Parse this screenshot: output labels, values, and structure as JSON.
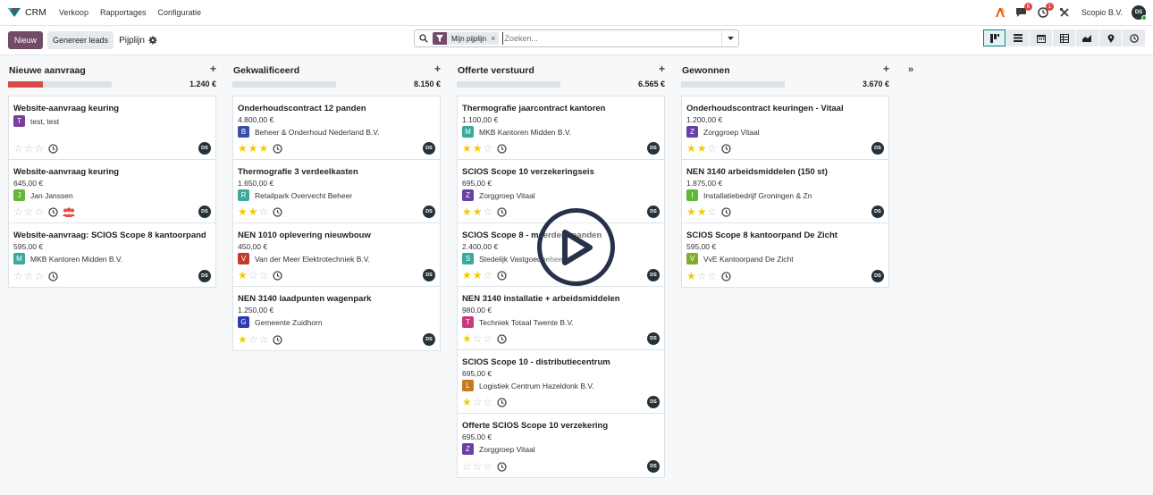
{
  "navbar": {
    "app_name": "CRM",
    "menu": [
      "Verkoop",
      "Rapportages",
      "Configuratie"
    ],
    "company": "Scopio B.V.",
    "user_initials": "DS",
    "messages_badge": "6",
    "activities_badge": "1"
  },
  "control": {
    "new_label": "Nieuw",
    "leads_label": "Genereer leads",
    "breadcrumb": "Pijplijn",
    "search": {
      "facet_label": "Mijn pijplijn",
      "facet_remove": "×",
      "placeholder": "Zoeken..."
    },
    "views": [
      "kanban",
      "list",
      "calendar",
      "pivot",
      "graph",
      "map",
      "activity"
    ],
    "active_view": "kanban"
  },
  "colors": {
    "primary": "#714b67",
    "accent": "#017e84",
    "star": "#f3cc00",
    "progress_red": "#d94b4b"
  },
  "columns": [
    {
      "title": "Nieuwe aanvraag",
      "add": "+",
      "total": "1.240 €",
      "progress_red_fraction": 0.34,
      "cards": [
        {
          "title": "Website-aanvraag keuring",
          "amount": "",
          "partner": "test, test",
          "initial": "T",
          "color": "#7b3f99",
          "stars": 0,
          "people_icon": false,
          "user": "DS"
        },
        {
          "title": "Website-aanvraag keuring",
          "amount": "645,00 €",
          "partner": "Jan Janssen",
          "initial": "J",
          "color": "#5fb932",
          "stars": 0,
          "people_icon": true,
          "user": "DS"
        },
        {
          "title": "Website-aanvraag: SCIOS Scope 8 kantoorpand",
          "amount": "595,00 €",
          "partner": "MKB Kantoren Midden B.V.",
          "initial": "M",
          "color": "#3aa9a0",
          "stars": 0,
          "people_icon": false,
          "user": "DS"
        }
      ]
    },
    {
      "title": "Gekwalificeerd",
      "add": "+",
      "total": "8.150 €",
      "progress_red_fraction": 0,
      "cards": [
        {
          "title": "Onderhoudscontract 12 panden",
          "amount": "4.800,00 €",
          "partner": "Beheer & Onderhoud Nederland B.V.",
          "initial": "B",
          "color": "#3c4fa8",
          "stars": 3,
          "user": "DS"
        },
        {
          "title": "Thermografie 3 verdeelkasten",
          "amount": "1.650,00 €",
          "partner": "Retailpark Overvecht Beheer",
          "initial": "R",
          "color": "#3aa9a0",
          "stars": 2,
          "user": "DS"
        },
        {
          "title": "NEN 1010 oplevering nieuwbouw",
          "amount": "450,00 €",
          "partner": "Van der Meer Elektrotechniek B.V.",
          "initial": "V",
          "color": "#c2392d",
          "stars": 1,
          "user": "DS"
        },
        {
          "title": "NEN 3140 laadpunten wagenpark",
          "amount": "1.250,00 €",
          "partner": "Gemeente Zuidhorn",
          "initial": "G",
          "color": "#2a3bb2",
          "stars": 1,
          "user": "DS"
        }
      ]
    },
    {
      "title": "Offerte verstuurd",
      "add": "+",
      "total": "6.565 €",
      "progress_red_fraction": 0,
      "cards": [
        {
          "title": "Thermografie jaarcontract kantoren",
          "amount": "1.100,00 €",
          "partner": "MKB Kantoren Midden B.V.",
          "initial": "M",
          "color": "#3aa9a0",
          "stars": 2,
          "user": "DS"
        },
        {
          "title": "SCIOS Scope 10 verzekeringseis",
          "amount": "695,00 €",
          "partner": "Zorggroep Vitaal",
          "initial": "Z",
          "color": "#6a3fa6",
          "stars": 2,
          "user": "DS"
        },
        {
          "title": "SCIOS Scope 8 - meerdere panden",
          "amount": "2.400,00 €",
          "partner": "Stedelijk Vastgoedbeheer",
          "initial": "S",
          "color": "#3aa9a0",
          "stars": 2,
          "user": "DS"
        },
        {
          "title": "NEN 3140 installatie + arbeidsmiddelen",
          "amount": "980,00 €",
          "partner": "Techniek Totaal Twente B.V.",
          "initial": "T",
          "color": "#c73b7d",
          "stars": 1,
          "user": "DS"
        },
        {
          "title": "SCIOS Scope 10 - distributiecentrum",
          "amount": "695,00 €",
          "partner": "Logistiek Centrum Hazeldonk B.V.",
          "initial": "L",
          "color": "#c17a20",
          "stars": 1,
          "user": "DS"
        },
        {
          "title": "Offerte SCIOS Scope 10 verzekering",
          "amount": "695,00 €",
          "partner": "Zorggroep Vitaal",
          "initial": "Z",
          "color": "#6a3fa6",
          "stars": 0,
          "user": "DS"
        }
      ]
    },
    {
      "title": "Gewonnen",
      "add": "+",
      "total": "3.670 €",
      "progress_red_fraction": 0,
      "cards": [
        {
          "title": "Onderhoudscontract keuringen - Vitaal",
          "amount": "1.200,00 €",
          "partner": "Zorggroep Vitaal",
          "initial": "Z",
          "color": "#6a3fa6",
          "stars": 2,
          "user": "DS"
        },
        {
          "title": "NEN 3140 arbeidsmiddelen (150 st)",
          "amount": "1.875,00 €",
          "partner": "Installatiebedrijf Groningen & Zn",
          "initial": "I",
          "color": "#5fb932",
          "stars": 2,
          "user": "DS"
        },
        {
          "title": "SCIOS Scope 8 kantoorpand De Zicht",
          "amount": "595,00 €",
          "partner": "VvE Kantoorpand De Zicht",
          "initial": "V",
          "color": "#7fae2a",
          "stars": 1,
          "user": "DS"
        }
      ]
    }
  ],
  "fold_toggle": "»"
}
